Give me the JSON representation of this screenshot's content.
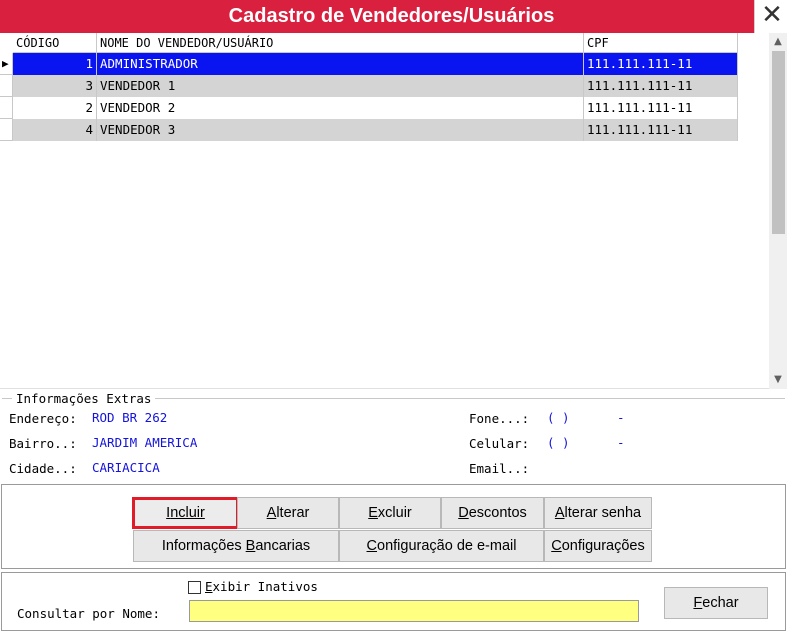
{
  "window": {
    "title": "Cadastro de Vendedores/Usuários",
    "close_glyph": "✕",
    "accent_color": "#d9203f"
  },
  "grid": {
    "columns": [
      "CÓDIGO",
      "NOME DO VENDEDOR/USUÁRIO",
      "CPF"
    ],
    "current_row_indicator": "▶",
    "rows": [
      {
        "code": "1",
        "name": "ADMINISTRADOR",
        "cpf": "111.111.111-11",
        "selected": true
      },
      {
        "code": "3",
        "name": "VENDEDOR 1",
        "cpf": "111.111.111-11",
        "selected": false
      },
      {
        "code": "2",
        "name": "VENDEDOR 2",
        "cpf": "111.111.111-11",
        "selected": false
      },
      {
        "code": "4",
        "name": "VENDEDOR 3",
        "cpf": "111.111.111-11",
        "selected": false
      }
    ],
    "scroll_up_glyph": "▲",
    "scroll_down_glyph": "▼",
    "selection_color": "#0a14f0"
  },
  "extras": {
    "legend": "Informações Extras",
    "endereco_label": "Endereço:",
    "endereco_value": "ROD BR 262",
    "bairro_label": "Bairro..:",
    "bairro_value": "JARDIM AMERICA",
    "cidade_label": "Cidade..:",
    "cidade_value": "CARIACICA",
    "fone_label": "Fone...:",
    "fone_value_area": "(  )",
    "fone_value_sep": "-",
    "celular_label": "Celular:",
    "celular_value_area": "(  )",
    "celular_value_sep": "-",
    "email_label": "Email..:",
    "value_color": "#1414dc"
  },
  "buttons": {
    "incluir": {
      "ul": "I",
      "rest": "ncluir"
    },
    "alterar": {
      "ul": "A",
      "rest": "lterar"
    },
    "excluir": {
      "ul": "E",
      "rest": "xcluir"
    },
    "descontos": {
      "ul": "D",
      "rest": "escontos"
    },
    "alterar_senha": {
      "ul": "A",
      "rest": "lterar senha"
    },
    "info_bancarias": {
      "pre": "Informações ",
      "ul": "B",
      "rest": "ancarias"
    },
    "config_email": {
      "ul": "C",
      "rest": "onfiguração de e-mail"
    },
    "configuracoes": {
      "ul": "C",
      "rest": "onfigurações"
    }
  },
  "footer": {
    "exibir_inativos": {
      "ul": "E",
      "rest": "xibir Inativos",
      "checked": false
    },
    "search_label": "Consultar por Nome:",
    "search_value": "",
    "search_bg": "#ffff80",
    "fechar": {
      "ul": "F",
      "rest": "echar"
    }
  }
}
